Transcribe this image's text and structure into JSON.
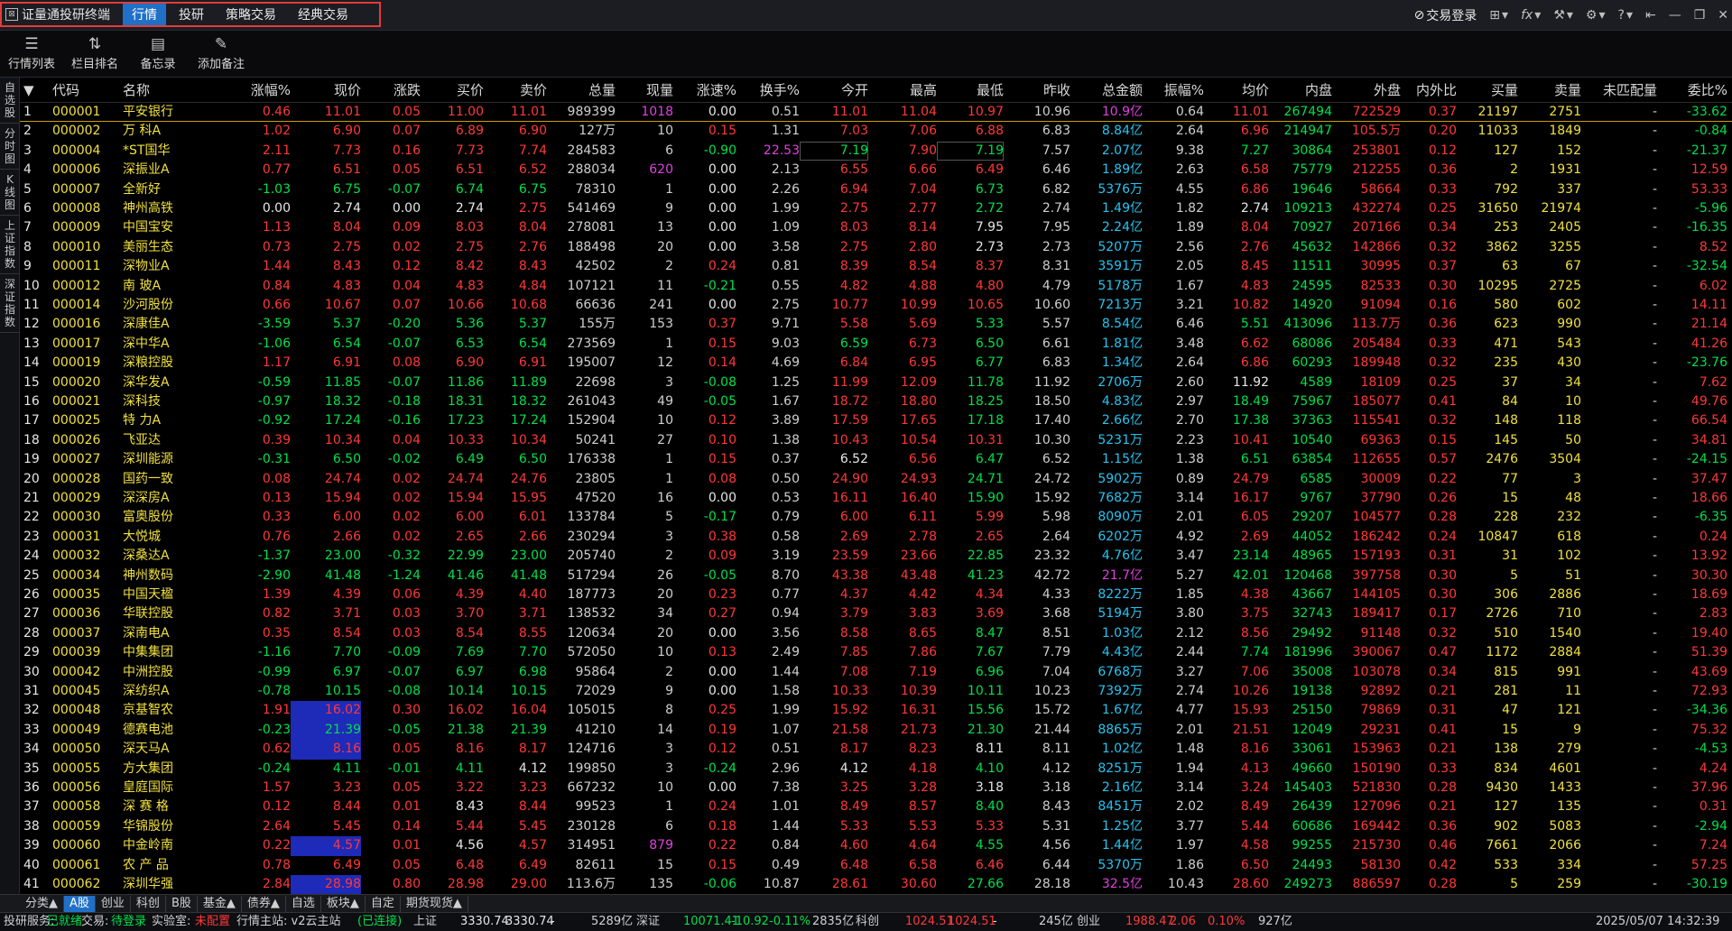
{
  "titlebar": {
    "app_title": "证量通投研终端",
    "tabs": [
      "行情",
      "投研",
      "策略交易",
      "经典交易"
    ],
    "active_tab": 0,
    "login": "交易登录"
  },
  "toolbar": {
    "items": [
      {
        "label": "行情列表",
        "icon": "list-icon"
      },
      {
        "label": "栏目排名",
        "icon": "sort-icon"
      },
      {
        "label": "备忘录",
        "icon": "memo-icon"
      },
      {
        "label": "添加备注",
        "icon": "edit-note-icon"
      }
    ]
  },
  "sidebar": {
    "items": [
      "自选股",
      "分时图",
      "K线图",
      "上证指数",
      "深证指数"
    ]
  },
  "colors": {
    "up": "#ff3838",
    "down": "#00e04a",
    "flat": "#e6e6e6",
    "amount": "#27c4f0",
    "accent": "#2070c8"
  },
  "table": {
    "headers": [
      "",
      "代码",
      "名称",
      "涨幅%",
      "现价",
      "涨跌",
      "买价",
      "卖价",
      "总量",
      "现量",
      "涨速%",
      "换手%",
      "今开",
      "最高",
      "最低",
      "昨收",
      "总金额",
      "振幅%",
      "均价",
      "内盘",
      "外盘",
      "内外比",
      "买量",
      "卖量",
      "未匹配量",
      "委比%"
    ],
    "rows": [
      [
        "1",
        "000001",
        "平安银行",
        "0.46",
        "11.01",
        "0.05",
        "11.00",
        "11.01",
        "989399",
        "1018",
        "0.00",
        "0.51",
        "11.01",
        "11.04",
        "10.97",
        "10.96",
        "10.9亿",
        "0.64",
        "11.01",
        "267494",
        "722529",
        "0.37",
        "21197",
        "2751",
        "-",
        "-33.62"
      ],
      [
        "2",
        "000002",
        "万 科A",
        "1.02",
        "6.90",
        "0.07",
        "6.89",
        "6.90",
        "127万",
        "10",
        "0.15",
        "1.31",
        "7.03",
        "7.06",
        "6.88",
        "6.83",
        "8.84亿",
        "2.64",
        "6.96",
        "214947",
        "105.5万",
        "0.20",
        "11033",
        "1849",
        "-",
        "-0.84"
      ],
      [
        "3",
        "000004",
        "*ST国华",
        "2.11",
        "7.73",
        "0.16",
        "7.73",
        "7.74",
        "284583",
        "6",
        "-0.90",
        "22.53",
        "7.19",
        "7.90",
        "7.19",
        "7.57",
        "2.07亿",
        "9.38",
        "7.27",
        "30864",
        "253801",
        "0.12",
        "127",
        "152",
        "-",
        "-21.37"
      ],
      [
        "4",
        "000006",
        "深振业A",
        "0.77",
        "6.51",
        "0.05",
        "6.51",
        "6.52",
        "288034",
        "620",
        "0.00",
        "2.13",
        "6.55",
        "6.66",
        "6.49",
        "6.46",
        "1.89亿",
        "2.63",
        "6.58",
        "75779",
        "212255",
        "0.36",
        "2",
        "1931",
        "-",
        "12.59"
      ],
      [
        "5",
        "000007",
        "全新好",
        "-1.03",
        "6.75",
        "-0.07",
        "6.74",
        "6.75",
        "78310",
        "1",
        "0.00",
        "2.26",
        "6.94",
        "7.04",
        "6.73",
        "6.82",
        "5376万",
        "4.55",
        "6.86",
        "19646",
        "58664",
        "0.33",
        "792",
        "337",
        "-",
        "53.33"
      ],
      [
        "6",
        "000008",
        "神州高铁",
        "0.00",
        "2.74",
        "0.00",
        "2.74",
        "2.75",
        "541469",
        "9",
        "0.00",
        "1.99",
        "2.75",
        "2.77",
        "2.72",
        "2.74",
        "1.49亿",
        "1.82",
        "2.74",
        "109213",
        "432274",
        "0.25",
        "31650",
        "21974",
        "-",
        "-5.96"
      ],
      [
        "7",
        "000009",
        "中国宝安",
        "1.13",
        "8.04",
        "0.09",
        "8.03",
        "8.04",
        "278081",
        "13",
        "0.00",
        "1.09",
        "8.03",
        "8.14",
        "7.95",
        "7.95",
        "2.24亿",
        "1.89",
        "8.04",
        "70927",
        "207166",
        "0.34",
        "253",
        "2405",
        "-",
        "-16.35"
      ],
      [
        "8",
        "000010",
        "美丽生态",
        "0.73",
        "2.75",
        "0.02",
        "2.75",
        "2.76",
        "188498",
        "20",
        "0.00",
        "3.58",
        "2.75",
        "2.80",
        "2.73",
        "2.73",
        "5207万",
        "2.56",
        "2.76",
        "45632",
        "142866",
        "0.32",
        "3862",
        "3255",
        "-",
        "8.52"
      ],
      [
        "9",
        "000011",
        "深物业A",
        "1.44",
        "8.43",
        "0.12",
        "8.42",
        "8.43",
        "42502",
        "2",
        "0.24",
        "0.81",
        "8.39",
        "8.54",
        "8.37",
        "8.31",
        "3591万",
        "2.05",
        "8.45",
        "11511",
        "30995",
        "0.37",
        "63",
        "67",
        "-",
        "-32.54"
      ],
      [
        "10",
        "000012",
        "南 玻A",
        "0.84",
        "4.83",
        "0.04",
        "4.83",
        "4.84",
        "107121",
        "11",
        "-0.21",
        "0.55",
        "4.82",
        "4.88",
        "4.80",
        "4.79",
        "5178万",
        "1.67",
        "4.83",
        "24595",
        "82533",
        "0.30",
        "10295",
        "2725",
        "-",
        "6.02"
      ],
      [
        "11",
        "000014",
        "沙河股份",
        "0.66",
        "10.67",
        "0.07",
        "10.66",
        "10.68",
        "66636",
        "241",
        "0.00",
        "2.75",
        "10.77",
        "10.99",
        "10.65",
        "10.60",
        "7213万",
        "3.21",
        "10.82",
        "14920",
        "91094",
        "0.16",
        "580",
        "602",
        "-",
        "14.11"
      ],
      [
        "12",
        "000016",
        "深康佳A",
        "-3.59",
        "5.37",
        "-0.20",
        "5.36",
        "5.37",
        "155万",
        "153",
        "0.37",
        "9.71",
        "5.58",
        "5.69",
        "5.33",
        "5.57",
        "8.54亿",
        "6.46",
        "5.51",
        "413096",
        "113.7万",
        "0.36",
        "623",
        "990",
        "-",
        "21.14"
      ],
      [
        "13",
        "000017",
        "深中华A",
        "-1.06",
        "6.54",
        "-0.07",
        "6.53",
        "6.54",
        "273569",
        "1",
        "0.15",
        "9.03",
        "6.59",
        "6.73",
        "6.50",
        "6.61",
        "1.81亿",
        "3.48",
        "6.62",
        "68086",
        "205484",
        "0.33",
        "471",
        "543",
        "-",
        "41.26"
      ],
      [
        "14",
        "000019",
        "深粮控股",
        "1.17",
        "6.91",
        "0.08",
        "6.90",
        "6.91",
        "195007",
        "12",
        "0.14",
        "4.69",
        "6.84",
        "6.95",
        "6.77",
        "6.83",
        "1.34亿",
        "2.64",
        "6.86",
        "60293",
        "189948",
        "0.32",
        "235",
        "430",
        "-",
        "-23.76"
      ],
      [
        "15",
        "000020",
        "深华发A",
        "-0.59",
        "11.85",
        "-0.07",
        "11.86",
        "11.89",
        "22698",
        "3",
        "-0.08",
        "1.25",
        "11.99",
        "12.09",
        "11.78",
        "11.92",
        "2706万",
        "2.60",
        "11.92",
        "4589",
        "18109",
        "0.25",
        "37",
        "34",
        "-",
        "7.62"
      ],
      [
        "16",
        "000021",
        "深科技",
        "-0.97",
        "18.32",
        "-0.18",
        "18.31",
        "18.32",
        "261043",
        "49",
        "-0.05",
        "1.67",
        "18.72",
        "18.80",
        "18.25",
        "18.50",
        "4.83亿",
        "2.97",
        "18.49",
        "75967",
        "185077",
        "0.41",
        "84",
        "10",
        "-",
        "49.76"
      ],
      [
        "17",
        "000025",
        "特 力A",
        "-0.92",
        "17.24",
        "-0.16",
        "17.23",
        "17.24",
        "152904",
        "10",
        "0.12",
        "3.89",
        "17.59",
        "17.65",
        "17.18",
        "17.40",
        "2.66亿",
        "2.70",
        "17.38",
        "37363",
        "115541",
        "0.32",
        "148",
        "118",
        "-",
        "66.54"
      ],
      [
        "18",
        "000026",
        "飞亚达",
        "0.39",
        "10.34",
        "0.04",
        "10.33",
        "10.34",
        "50241",
        "27",
        "0.10",
        "1.38",
        "10.43",
        "10.54",
        "10.31",
        "10.30",
        "5231万",
        "2.23",
        "10.41",
        "10540",
        "69363",
        "0.15",
        "145",
        "50",
        "-",
        "34.81"
      ],
      [
        "19",
        "000027",
        "深圳能源",
        "-0.31",
        "6.50",
        "-0.02",
        "6.49",
        "6.50",
        "176338",
        "1",
        "0.15",
        "0.37",
        "6.52",
        "6.56",
        "6.47",
        "6.52",
        "1.15亿",
        "1.38",
        "6.51",
        "63854",
        "112655",
        "0.57",
        "2476",
        "3504",
        "-",
        "-24.15"
      ],
      [
        "20",
        "000028",
        "国药一致",
        "0.08",
        "24.74",
        "0.02",
        "24.74",
        "24.76",
        "23805",
        "1",
        "0.08",
        "0.50",
        "24.90",
        "24.93",
        "24.71",
        "24.72",
        "5902万",
        "0.89",
        "24.79",
        "6585",
        "30009",
        "0.22",
        "77",
        "3",
        "-",
        "37.47"
      ],
      [
        "21",
        "000029",
        "深深房A",
        "0.13",
        "15.94",
        "0.02",
        "15.94",
        "15.95",
        "47520",
        "16",
        "0.00",
        "0.53",
        "16.11",
        "16.40",
        "15.90",
        "15.92",
        "7682万",
        "3.14",
        "16.17",
        "9767",
        "37790",
        "0.26",
        "15",
        "48",
        "-",
        "18.66"
      ],
      [
        "22",
        "000030",
        "富奥股份",
        "0.33",
        "6.00",
        "0.02",
        "6.00",
        "6.01",
        "133784",
        "5",
        "-0.17",
        "0.79",
        "6.00",
        "6.11",
        "5.99",
        "5.98",
        "8090万",
        "2.01",
        "6.05",
        "29207",
        "104577",
        "0.28",
        "228",
        "232",
        "-",
        "-6.35"
      ],
      [
        "23",
        "000031",
        "大悦城",
        "0.76",
        "2.66",
        "0.02",
        "2.65",
        "2.66",
        "230294",
        "3",
        "0.38",
        "0.58",
        "2.69",
        "2.78",
        "2.65",
        "2.64",
        "6202万",
        "4.92",
        "2.69",
        "44052",
        "186242",
        "0.24",
        "10847",
        "618",
        "-",
        "0.24"
      ],
      [
        "24",
        "000032",
        "深桑达A",
        "-1.37",
        "23.00",
        "-0.32",
        "22.99",
        "23.00",
        "205740",
        "2",
        "0.09",
        "3.19",
        "23.59",
        "23.66",
        "22.85",
        "23.32",
        "4.76亿",
        "3.47",
        "23.14",
        "48965",
        "157193",
        "0.31",
        "31",
        "102",
        "-",
        "13.92"
      ],
      [
        "25",
        "000034",
        "神州数码",
        "-2.90",
        "41.48",
        "-1.24",
        "41.46",
        "41.48",
        "517294",
        "26",
        "-0.05",
        "8.70",
        "43.38",
        "43.48",
        "41.23",
        "42.72",
        "21.7亿",
        "5.27",
        "42.01",
        "120468",
        "397758",
        "0.30",
        "5",
        "51",
        "-",
        "30.30"
      ],
      [
        "26",
        "000035",
        "中国天楹",
        "1.39",
        "4.39",
        "0.06",
        "4.39",
        "4.40",
        "187773",
        "20",
        "0.23",
        "0.77",
        "4.37",
        "4.42",
        "4.34",
        "4.33",
        "8222万",
        "1.85",
        "4.38",
        "43667",
        "144105",
        "0.30",
        "306",
        "2886",
        "-",
        "18.69"
      ],
      [
        "27",
        "000036",
        "华联控股",
        "0.82",
        "3.71",
        "0.03",
        "3.70",
        "3.71",
        "138532",
        "34",
        "0.27",
        "0.94",
        "3.79",
        "3.83",
        "3.69",
        "3.68",
        "5194万",
        "3.80",
        "3.75",
        "32743",
        "189417",
        "0.17",
        "2726",
        "710",
        "-",
        "2.83"
      ],
      [
        "28",
        "000037",
        "深南电A",
        "0.35",
        "8.54",
        "0.03",
        "8.54",
        "8.55",
        "120634",
        "20",
        "0.00",
        "3.56",
        "8.58",
        "8.65",
        "8.47",
        "8.51",
        "1.03亿",
        "2.12",
        "8.56",
        "29492",
        "91148",
        "0.32",
        "510",
        "1540",
        "-",
        "19.40"
      ],
      [
        "29",
        "000039",
        "中集集团",
        "-1.16",
        "7.70",
        "-0.09",
        "7.69",
        "7.70",
        "572050",
        "10",
        "0.13",
        "2.49",
        "7.85",
        "7.86",
        "7.67",
        "7.79",
        "4.43亿",
        "2.44",
        "7.74",
        "181996",
        "390067",
        "0.47",
        "1172",
        "2884",
        "-",
        "51.39"
      ],
      [
        "30",
        "000042",
        "中洲控股",
        "-0.99",
        "6.97",
        "-0.07",
        "6.97",
        "6.98",
        "95864",
        "2",
        "0.00",
        "1.44",
        "7.08",
        "7.19",
        "6.96",
        "7.04",
        "6768万",
        "3.27",
        "7.06",
        "35008",
        "103078",
        "0.34",
        "815",
        "991",
        "-",
        "43.69"
      ],
      [
        "31",
        "000045",
        "深纺织A",
        "-0.78",
        "10.15",
        "-0.08",
        "10.14",
        "10.15",
        "72029",
        "9",
        "0.00",
        "1.58",
        "10.33",
        "10.39",
        "10.11",
        "10.23",
        "7392万",
        "2.74",
        "10.26",
        "19138",
        "92892",
        "0.21",
        "281",
        "11",
        "-",
        "72.93"
      ],
      [
        "32",
        "000048",
        "京基智农",
        "1.91",
        "16.02",
        "0.30",
        "16.02",
        "16.04",
        "105015",
        "8",
        "0.25",
        "1.99",
        "15.92",
        "16.31",
        "15.56",
        "15.72",
        "1.67亿",
        "4.77",
        "15.93",
        "25150",
        "79869",
        "0.31",
        "47",
        "121",
        "-",
        "-34.36"
      ],
      [
        "33",
        "000049",
        "德赛电池",
        "-0.23",
        "21.39",
        "-0.05",
        "21.38",
        "21.39",
        "41210",
        "14",
        "0.19",
        "1.07",
        "21.58",
        "21.73",
        "21.30",
        "21.44",
        "8865万",
        "2.01",
        "21.51",
        "12049",
        "29231",
        "0.41",
        "15",
        "9",
        "-",
        "75.32"
      ],
      [
        "34",
        "000050",
        "深天马A",
        "0.62",
        "8.16",
        "0.05",
        "8.16",
        "8.17",
        "124716",
        "3",
        "0.12",
        "0.51",
        "8.17",
        "8.23",
        "8.11",
        "8.11",
        "1.02亿",
        "1.48",
        "8.16",
        "33061",
        "153963",
        "0.21",
        "138",
        "279",
        "-",
        "-4.53"
      ],
      [
        "35",
        "000055",
        "方大集团",
        "-0.24",
        "4.11",
        "-0.01",
        "4.11",
        "4.12",
        "199850",
        "3",
        "-0.24",
        "2.96",
        "4.12",
        "4.18",
        "4.10",
        "4.12",
        "8251万",
        "1.94",
        "4.13",
        "49660",
        "150190",
        "0.33",
        "834",
        "4601",
        "-",
        "4.24"
      ],
      [
        "36",
        "000056",
        "皇庭国际",
        "1.57",
        "3.23",
        "0.05",
        "3.22",
        "3.23",
        "667232",
        "10",
        "0.00",
        "7.38",
        "3.25",
        "3.28",
        "3.18",
        "3.18",
        "2.16亿",
        "3.14",
        "3.24",
        "145403",
        "521830",
        "0.28",
        "9430",
        "1433",
        "-",
        "37.96"
      ],
      [
        "37",
        "000058",
        "深 赛 格",
        "0.12",
        "8.44",
        "0.01",
        "8.43",
        "8.44",
        "99523",
        "1",
        "0.24",
        "1.01",
        "8.49",
        "8.57",
        "8.40",
        "8.43",
        "8451万",
        "2.02",
        "8.49",
        "26439",
        "127096",
        "0.21",
        "127",
        "135",
        "-",
        "0.31"
      ],
      [
        "38",
        "000059",
        "华锦股份",
        "2.64",
        "5.45",
        "0.14",
        "5.44",
        "5.45",
        "230128",
        "6",
        "0.18",
        "1.44",
        "5.33",
        "5.53",
        "5.33",
        "5.31",
        "1.25亿",
        "3.77",
        "5.44",
        "60686",
        "169442",
        "0.36",
        "902",
        "5083",
        "-",
        "-2.94"
      ],
      [
        "39",
        "000060",
        "中金岭南",
        "0.22",
        "4.57",
        "0.01",
        "4.56",
        "4.57",
        "314951",
        "879",
        "0.22",
        "0.84",
        "4.60",
        "4.64",
        "4.55",
        "4.56",
        "1.44亿",
        "1.97",
        "4.58",
        "99255",
        "215730",
        "0.46",
        "7661",
        "2066",
        "-",
        "7.24"
      ],
      [
        "40",
        "000061",
        "农 产 品",
        "0.78",
        "6.49",
        "0.05",
        "6.48",
        "6.49",
        "82611",
        "15",
        "0.15",
        "0.49",
        "6.48",
        "6.58",
        "6.46",
        "6.44",
        "5370万",
        "1.86",
        "6.50",
        "24493",
        "58130",
        "0.42",
        "533",
        "334",
        "-",
        "57.25"
      ],
      [
        "41",
        "000062",
        "深圳华强",
        "2.84",
        "28.98",
        "0.80",
        "28.98",
        "29.00",
        "113.6万",
        "135",
        "-0.06",
        "10.87",
        "28.61",
        "30.60",
        "27.66",
        "28.18",
        "32.5亿",
        "10.43",
        "28.60",
        "249273",
        "886597",
        "0.28",
        "5",
        "259",
        "-",
        "-30.19"
      ]
    ]
  },
  "bottom_tabs": [
    "分类▲",
    "A股",
    "创业",
    "科创",
    "B股",
    "基金▲",
    "债券▲",
    "自选",
    "板块▲",
    "自定",
    "期货现货▲"
  ],
  "bottom_active": 1,
  "status": {
    "service_label": "投研服务:",
    "service_value": "已就绪",
    "trade_label": "交易:",
    "trade_value": "待登录",
    "lab_label": "实验室:",
    "lab_value": "未配置",
    "server_label": "行情主站: v2云主站",
    "server_value": "(已连接)",
    "sh_label": "上证",
    "sh_index": "3330.74",
    "sh_index2": "3330.74",
    "sh_change": "-",
    "sh_amount": "5289亿",
    "sz_label": "深证",
    "sz_index": "10071.41",
    "sz_change": "-10.92",
    "sz_pct": "-0.11%",
    "sz_amount": "2835亿",
    "kc_label": "科创",
    "kc_index": "1024.51",
    "kc_index2": "1024.51",
    "kc_change": "-",
    "kc_amount": "245亿",
    "cy_label": "创业",
    "cy_index": "1988.47",
    "cy_change": "2.06",
    "cy_pct": "0.10%",
    "cy_amount": "927亿",
    "datetime": "2025/05/07  14:32:39"
  }
}
